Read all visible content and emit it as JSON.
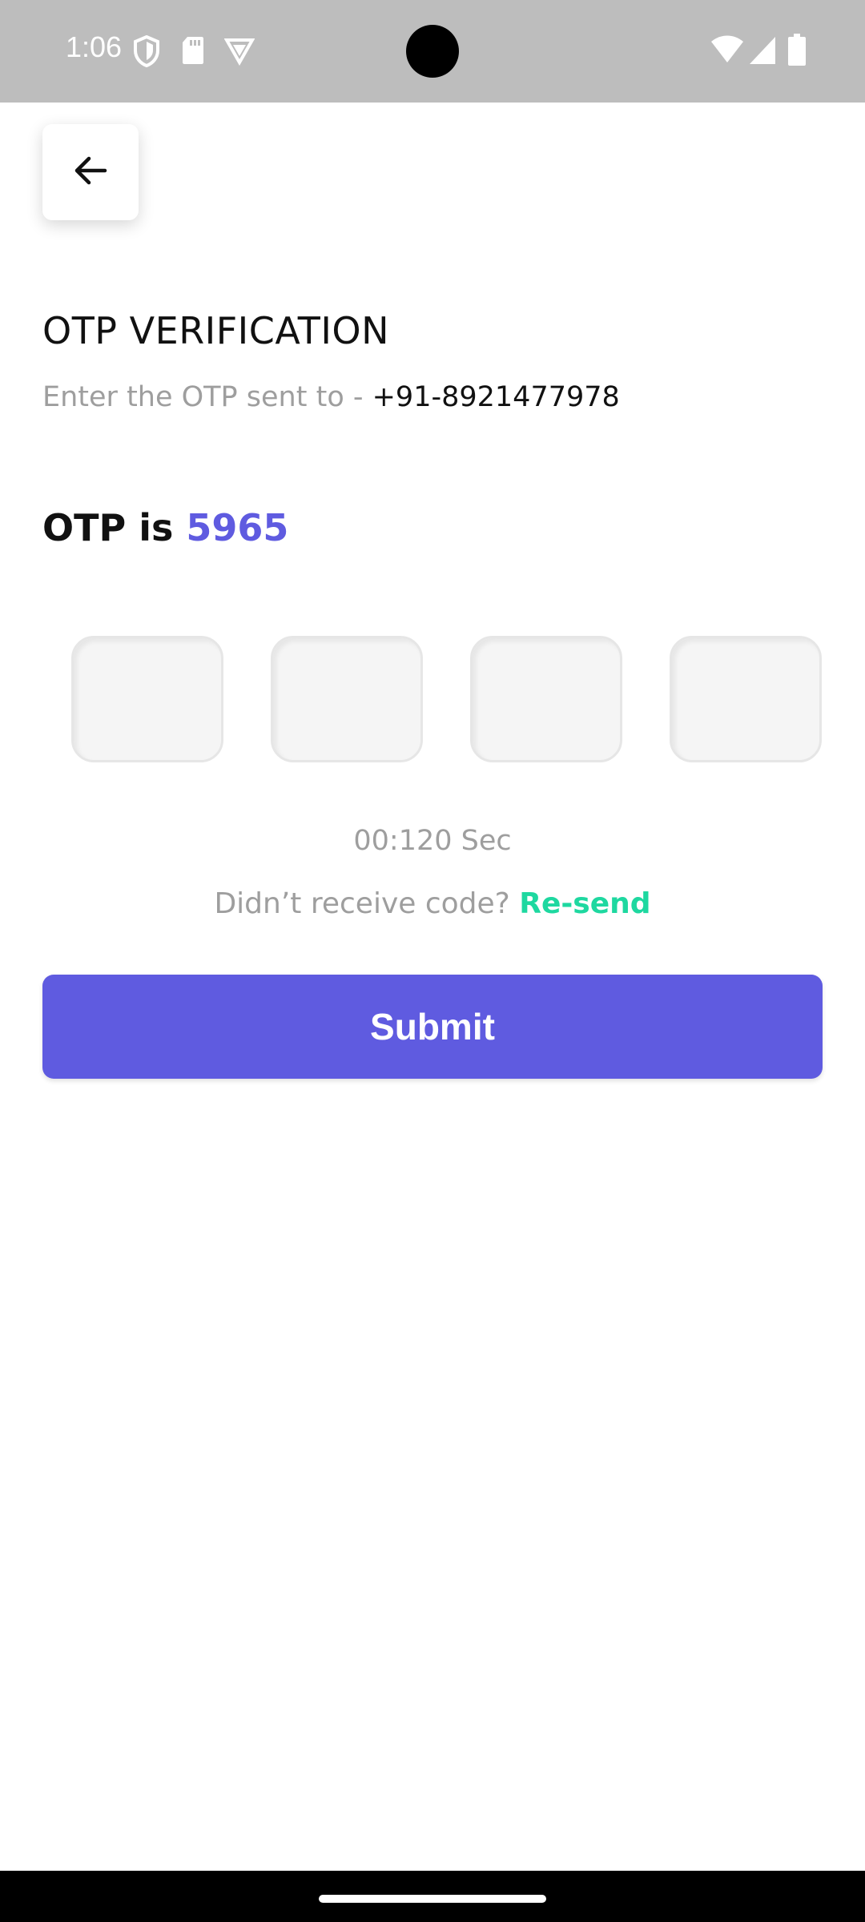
{
  "status_bar": {
    "time": "1:06",
    "left_icons": [
      "shield-icon",
      "sd-card-icon",
      "vpn-icon"
    ],
    "right_icons": [
      "wifi-icon",
      "signal-icon",
      "battery-icon"
    ]
  },
  "header": {
    "back_icon": "arrow-left-icon",
    "title": "OTP VERIFICATION",
    "subtitle_prefix": "Enter the OTP sent to - ",
    "phone": "+91-8921477978"
  },
  "otp_hint": {
    "prefix": "OTP is ",
    "code": "5965"
  },
  "otp_inputs": [
    "",
    "",
    "",
    ""
  ],
  "timer": "00:120 Sec",
  "resend": {
    "prompt": "Didn’t receive code? ",
    "link": "Re-send"
  },
  "submit_label": "Submit",
  "colors": {
    "accent": "#5f5be0",
    "resend": "#1ed8a0",
    "status_bar": "#bdbdbd",
    "muted_text": "#9e9e9e"
  }
}
